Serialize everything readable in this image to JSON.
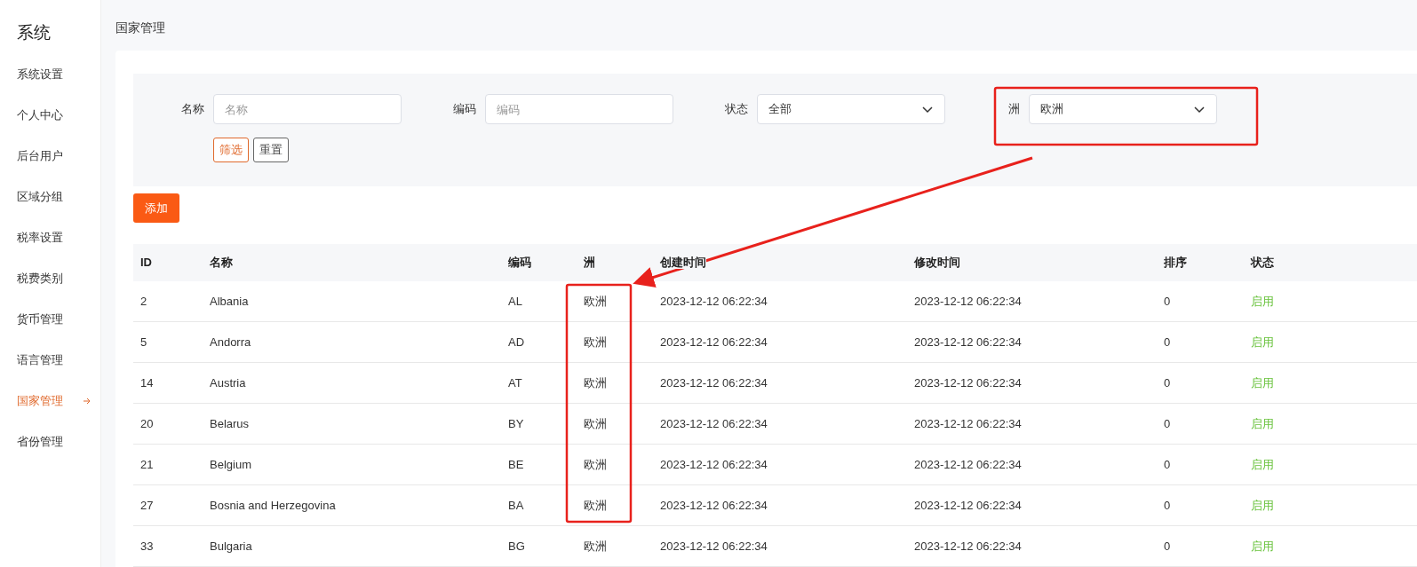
{
  "sidebar": {
    "title": "系统",
    "items": [
      {
        "label": "系统设置",
        "selected": false
      },
      {
        "label": "个人中心",
        "selected": false
      },
      {
        "label": "后台用户",
        "selected": false
      },
      {
        "label": "区域分组",
        "selected": false
      },
      {
        "label": "税率设置",
        "selected": false
      },
      {
        "label": "税费类别",
        "selected": false
      },
      {
        "label": "货币管理",
        "selected": false
      },
      {
        "label": "语言管理",
        "selected": false
      },
      {
        "label": "国家管理",
        "selected": true
      },
      {
        "label": "省份管理",
        "selected": false
      }
    ]
  },
  "page_title": "国家管理",
  "filters": [
    {
      "kind": "input",
      "label": "名称",
      "placeholder": "名称"
    },
    {
      "kind": "input",
      "label": "编码",
      "placeholder": "编码"
    },
    {
      "kind": "select",
      "label": "状态",
      "value": "全部"
    },
    {
      "kind": "select",
      "label": "洲",
      "value": "欧洲"
    }
  ],
  "filter_buttons": [
    {
      "label": "筛选",
      "kind": "primary"
    },
    {
      "label": "重置",
      "kind": "default"
    }
  ],
  "add_button": "添加",
  "table": {
    "columns": [
      "ID",
      "名称",
      "编码",
      "洲",
      "创建时间",
      "修改时间",
      "排序",
      "状态"
    ],
    "rows": [
      [
        "2",
        "Albania",
        "AL",
        "欧洲",
        "2023-12-12 06:22:34",
        "2023-12-12 06:22:34",
        "0",
        "启用"
      ],
      [
        "5",
        "Andorra",
        "AD",
        "欧洲",
        "2023-12-12 06:22:34",
        "2023-12-12 06:22:34",
        "0",
        "启用"
      ],
      [
        "14",
        "Austria",
        "AT",
        "欧洲",
        "2023-12-12 06:22:34",
        "2023-12-12 06:22:34",
        "0",
        "启用"
      ],
      [
        "20",
        "Belarus",
        "BY",
        "欧洲",
        "2023-12-12 06:22:34",
        "2023-12-12 06:22:34",
        "0",
        "启用"
      ],
      [
        "21",
        "Belgium",
        "BE",
        "欧洲",
        "2023-12-12 06:22:34",
        "2023-12-12 06:22:34",
        "0",
        "启用"
      ],
      [
        "27",
        "Bosnia and Herzegovina",
        "BA",
        "欧洲",
        "2023-12-12 06:22:34",
        "2023-12-12 06:22:34",
        "0",
        "启用"
      ],
      [
        "33",
        "Bulgaria",
        "BG",
        "欧洲",
        "2023-12-12 06:22:34",
        "2023-12-12 06:22:34",
        "0",
        "启用"
      ]
    ]
  }
}
